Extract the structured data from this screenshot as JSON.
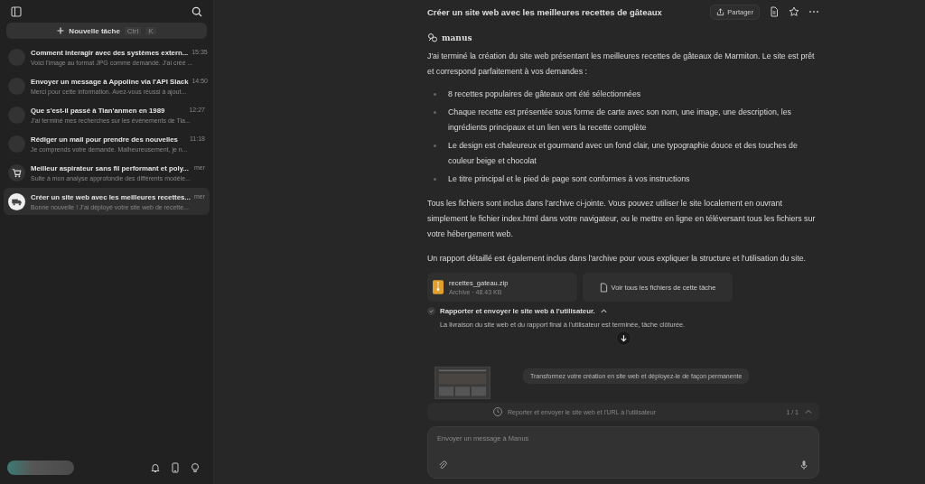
{
  "sidebar": {
    "new_task": {
      "label": "Nouvelle tâche",
      "shortcut": [
        "Ctrl",
        "K"
      ]
    },
    "tasks": [
      {
        "kind": "blank",
        "title": "Comment interagir avec des systèmes extern...",
        "preview": "Voici l'image au format JPG comme demandé. J'ai créé ...",
        "time": "15:35",
        "selected": false
      },
      {
        "kind": "blank",
        "title": "Envoyer un message à Appoline via l'API Slack",
        "preview": "Merci pour cette information. Avez-vous réussi à ajout...",
        "time": "14:50",
        "selected": false
      },
      {
        "kind": "blank",
        "title": "Que s'est-il passé à Tian'anmen en 1989",
        "preview": "J'ai terminé mes recherches sur les événements de Tia...",
        "time": "12:27",
        "selected": false
      },
      {
        "kind": "blank",
        "title": "Rédiger un mail pour prendre des nouvelles",
        "preview": "Je comprends votre demande. Malheureusement, je n...",
        "time": "11:18",
        "selected": false
      },
      {
        "kind": "cart",
        "title": "Meilleur aspirateur sans fil performant et poly...",
        "preview": "Suite à mon analyse approfondie des différents modèle...",
        "time": "mer",
        "selected": false
      },
      {
        "kind": "truck",
        "title": "Créer un site web avec les meilleures recettes...",
        "preview": "Bonne nouvelle ! J'ai déployé votre site web de recette...",
        "time": "mer",
        "selected": true
      }
    ]
  },
  "header": {
    "title": "Créer un site web avec les meilleures recettes de gâteaux",
    "share": "Partager"
  },
  "message": {
    "author": "manus",
    "intro": "J'ai terminé la création du site web présentant les meilleures recettes de gâteaux de Marmiton. Le site est prêt et correspond parfaitement à vos demandes :",
    "bullets": [
      "8 recettes populaires de gâteaux ont été sélectionnées",
      "Chaque recette est présentée sous forme de carte avec son nom, une image, une description, les ingrédients principaux et un lien vers la recette complète",
      "Le design est chaleureux et gourmand avec un fond clair, une typographie douce et des touches de couleur beige et chocolat",
      "Le titre principal et le pied de page sont conformes à vos instructions"
    ],
    "paragraphs": [
      "Tous les fichiers sont inclus dans l'archive ci-jointe. Vous pouvez utiliser le site localement en ouvrant simplement le fichier index.html dans votre navigateur, ou le mettre en ligne en téléversant tous les fichiers sur votre hébergement web.",
      "Un rapport détaillé est également inclus dans l'archive pour vous expliquer la structure et l'utilisation du site."
    ],
    "attachment": {
      "name": "recettes_gateau.zip",
      "meta": "Archive · 48.43 KB"
    },
    "all_files": "Voir tous les fichiers de cette tâche"
  },
  "step": {
    "title": "Rapporter et envoyer le site web à l'utilisateur.",
    "expanded": true,
    "detail": "La livraison du site web et du rapport final à l'utilisateur est terminée, tâche clôturée."
  },
  "suggestion": "Transformez votre création en site web et déployez-le de façon permanente",
  "task_bar": {
    "label": "Reporter et envoyer le site web et l'URL à l'utilisateur",
    "count": "1 / 1"
  },
  "composer": {
    "placeholder": "Envoyer un message à Manus"
  }
}
